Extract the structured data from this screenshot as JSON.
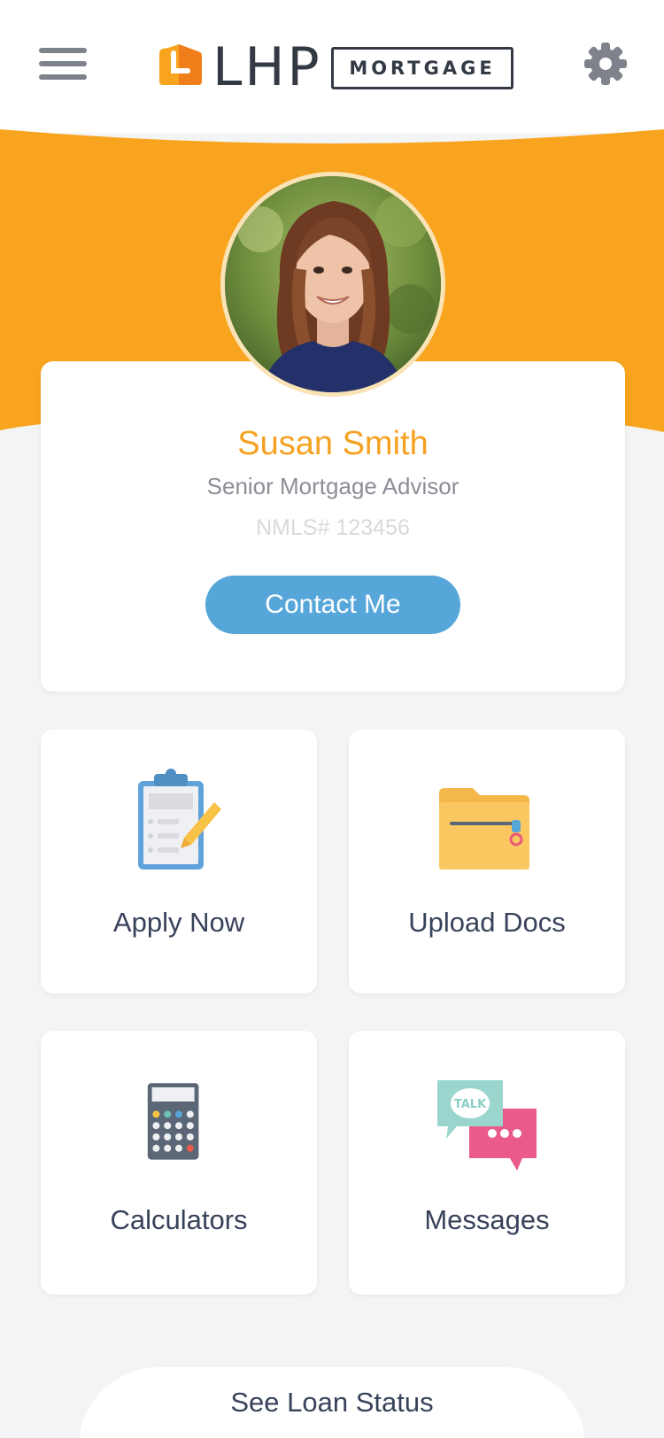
{
  "header": {
    "brand_name": "LHP",
    "brand_tag": "MORTGAGE",
    "icons": {
      "menu": "hamburger-menu-icon",
      "settings": "gear-icon",
      "logo": "lhp-logo-mark"
    }
  },
  "advisor": {
    "name": "Susan Smith",
    "title": "Senior Mortgage Advisor",
    "nmls": "NMLS# 123456",
    "contact_label": "Contact Me"
  },
  "actions": [
    {
      "label": "Apply Now",
      "icon": "clipboard-pencil-icon"
    },
    {
      "label": "Upload Docs",
      "icon": "folder-zipper-icon"
    },
    {
      "label": "Calculators",
      "icon": "calculator-icon"
    },
    {
      "label": "Messages",
      "icon": "chat-bubbles-icon",
      "bubble_text": "TALK"
    }
  ],
  "loan_status_label": "See Loan Status",
  "colors": {
    "brand_orange": "#F9A41E",
    "accent_blue": "#56A6DA",
    "name_orange": "#F5A121",
    "text_dark": "#38425A",
    "background": "#F3F4F6"
  }
}
